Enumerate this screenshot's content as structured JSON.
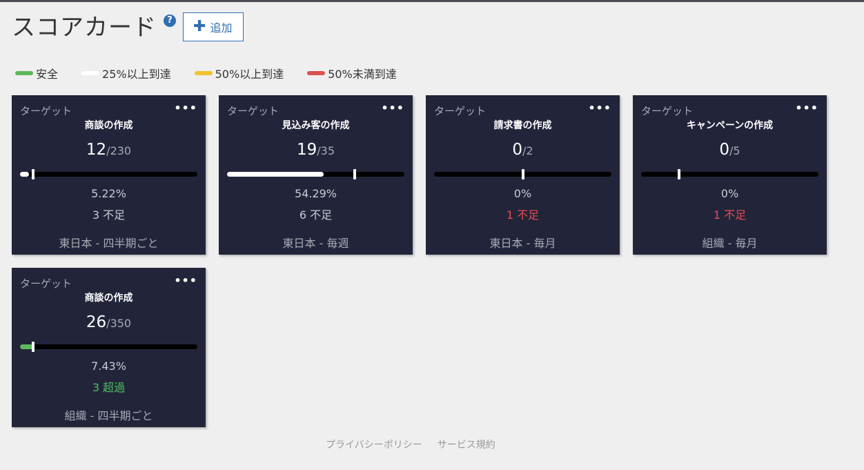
{
  "header": {
    "title": "スコアカード",
    "help": "?",
    "add_label": "追加"
  },
  "legend": [
    {
      "label": "安全",
      "color": "#5cb85c"
    },
    {
      "label": "25%以上到達",
      "color": "#ffffff"
    },
    {
      "label": "50%以上到達",
      "color": "#f0c330"
    },
    {
      "label": "50%未満到達",
      "color": "#d9534f"
    }
  ],
  "colors": {
    "card_bg": "#22253a",
    "status_red": "#e94c50",
    "status_green": "#4fbf62",
    "status_default": "#c9cad1"
  },
  "cards": [
    {
      "label": "ターゲット",
      "menu": "•••",
      "name": "商談の作成",
      "current": "12",
      "target": "/230",
      "percent": "5.22%",
      "progress": 0.0522,
      "marker": 0.075,
      "fill_color": "#ffffff",
      "status": "3 不足",
      "status_type": "default",
      "period": "東日本 - 四半期ごと"
    },
    {
      "label": "ターゲット",
      "menu": "•••",
      "name": "見込み客の作成",
      "current": "19",
      "target": "/35",
      "percent": "54.29%",
      "progress": 0.5429,
      "marker": 0.72,
      "fill_color": "#ffffff",
      "status": "6 不足",
      "status_type": "default",
      "period": "東日本 - 毎週"
    },
    {
      "label": "ターゲット",
      "menu": "•••",
      "name": "請求書の作成",
      "current": "0",
      "target": "/2",
      "percent": "0%",
      "progress": 0,
      "marker": 0.5,
      "fill_color": "#ffffff",
      "status": "1 不足",
      "status_type": "red",
      "period": "東日本 - 毎月"
    },
    {
      "label": "ターゲット",
      "menu": "•••",
      "name": "キャンペーンの作成",
      "current": "0",
      "target": "/5",
      "percent": "0%",
      "progress": 0,
      "marker": 0.215,
      "fill_color": "#ffffff",
      "status": "1 不足",
      "status_type": "red",
      "period": "組織 - 毎月"
    },
    {
      "label": "ターゲット",
      "menu": "•••",
      "name": "商談の作成",
      "current": "26",
      "target": "/350",
      "percent": "7.43%",
      "progress": 0.0743,
      "marker": 0.075,
      "fill_color": "#5cb85c",
      "status": "3 超過",
      "status_type": "green",
      "period": "組織 - 四半期ごと"
    }
  ],
  "footer": {
    "privacy": "プライバシーポリシー",
    "terms": "サービス規約"
  }
}
